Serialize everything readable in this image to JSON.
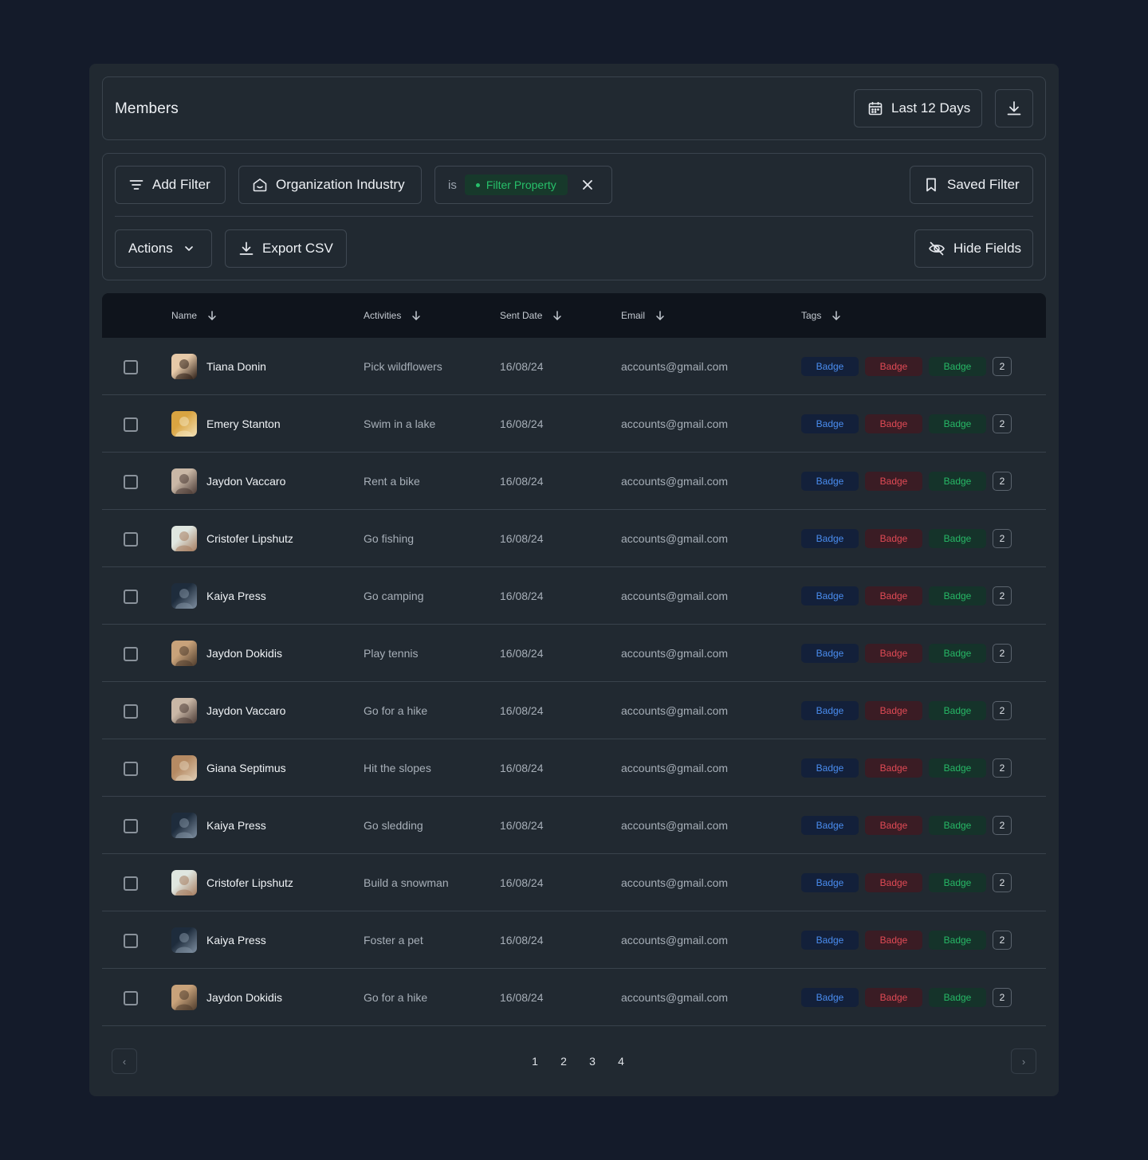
{
  "header": {
    "title": "Members",
    "date_range_label": "Last 12 Days"
  },
  "filters": {
    "add_filter_label": "Add Filter",
    "org_industry_label": "Organization Industry",
    "condition_op": "is",
    "condition_value": "Filter Property",
    "saved_filter_label": "Saved Filter",
    "actions_label": "Actions",
    "export_label": "Export CSV",
    "hide_fields_label": "Hide Fields"
  },
  "table": {
    "columns": [
      "Name",
      "Activities",
      "Sent Date",
      "Email",
      "Tags"
    ],
    "rows": [
      {
        "name": "Tiana Donin",
        "activity": "Pick wildflowers",
        "date": "16/08/24",
        "email": "accounts@gmail.com",
        "avatar_colors": [
          "#e6c9a8",
          "#2b1d16"
        ]
      },
      {
        "name": "Emery Stanton",
        "activity": "Swim in a lake",
        "date": "16/08/24",
        "email": "accounts@gmail.com",
        "avatar_colors": [
          "#d9a441",
          "#f3e2b8"
        ]
      },
      {
        "name": "Jaydon Vaccaro",
        "activity": "Rent a bike",
        "date": "16/08/24",
        "email": "accounts@gmail.com",
        "avatar_colors": [
          "#c9b7a6",
          "#4a3a35"
        ]
      },
      {
        "name": "Cristofer Lipshutz",
        "activity": "Go fishing",
        "date": "16/08/24",
        "email": "accounts@gmail.com",
        "avatar_colors": [
          "#dfe6e0",
          "#a57c5f"
        ]
      },
      {
        "name": "Kaiya Press",
        "activity": "Go camping",
        "date": "16/08/24",
        "email": "accounts@gmail.com",
        "avatar_colors": [
          "#1e2c3c",
          "#7f8fa1"
        ]
      },
      {
        "name": "Jaydon Dokidis",
        "activity": "Play tennis",
        "date": "16/08/24",
        "email": "accounts@gmail.com",
        "avatar_colors": [
          "#c8a27a",
          "#4d3b2c"
        ]
      },
      {
        "name": "Jaydon Vaccaro",
        "activity": "Go for a hike",
        "date": "16/08/24",
        "email": "accounts@gmail.com",
        "avatar_colors": [
          "#c9b7a6",
          "#4a3a35"
        ]
      },
      {
        "name": "Giana Septimus",
        "activity": "Hit the slopes",
        "date": "16/08/24",
        "email": "accounts@gmail.com",
        "avatar_colors": [
          "#b58a63",
          "#e0cdb5"
        ]
      },
      {
        "name": "Kaiya Press",
        "activity": "Go sledding",
        "date": "16/08/24",
        "email": "accounts@gmail.com",
        "avatar_colors": [
          "#1e2c3c",
          "#7f8fa1"
        ]
      },
      {
        "name": "Cristofer Lipshutz",
        "activity": "Build a snowman",
        "date": "16/08/24",
        "email": "accounts@gmail.com",
        "avatar_colors": [
          "#dfe6e0",
          "#a57c5f"
        ]
      },
      {
        "name": "Kaiya Press",
        "activity": "Foster a pet",
        "date": "16/08/24",
        "email": "accounts@gmail.com",
        "avatar_colors": [
          "#1e2c3c",
          "#7f8fa1"
        ]
      },
      {
        "name": "Jaydon Dokidis",
        "activity": "Go for a hike",
        "date": "16/08/24",
        "email": "accounts@gmail.com",
        "avatar_colors": [
          "#c8a27a",
          "#4d3b2c"
        ]
      }
    ],
    "badges": [
      {
        "label": "Badge",
        "color": "#4a8df0"
      },
      {
        "label": "Badge",
        "color": "#e04a55"
      },
      {
        "label": "Badge",
        "color": "#27b866"
      }
    ],
    "extra_count": "2"
  },
  "pagination": {
    "pages": [
      "1",
      "2",
      "3",
      "4"
    ],
    "prev_glyph": "‹",
    "next_glyph": "›"
  },
  "icons": [
    "calendar-icon",
    "download-icon",
    "filter-lines-icon",
    "building-icon",
    "close-icon",
    "bookmark-icon",
    "chevron-down-icon",
    "export-icon",
    "eye-off-icon",
    "sort-arrow-icon"
  ]
}
